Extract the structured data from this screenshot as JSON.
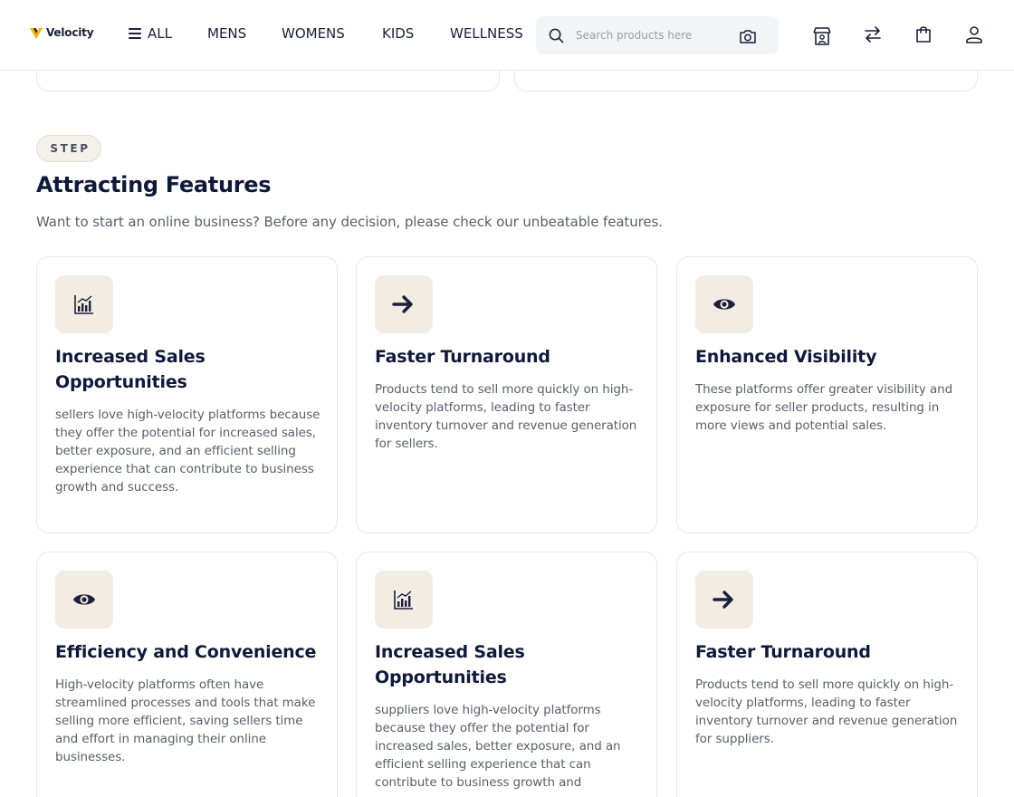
{
  "header": {
    "logo_text": "Velocity",
    "nav": [
      "ALL",
      "MENS",
      "WOMENS",
      "KIDS",
      "WELLNESS"
    ],
    "search_placeholder": "Search products here",
    "icons": [
      "store-icon",
      "compare-icon",
      "bag-icon",
      "user-icon"
    ]
  },
  "section": {
    "badge": "STEP",
    "title": "Attracting Features",
    "subtitle": "Want to start an online business? Before any decision, please check our unbeatable features."
  },
  "cards": [
    {
      "icon": "chart-icon",
      "title": "Increased Sales Opportunities",
      "desc": "sellers love high-velocity platforms because they offer the potential for increased sales, better exposure, and an efficient selling experience that can contribute to business growth and success."
    },
    {
      "icon": "arrow-right-icon",
      "title": "Faster Turnaround",
      "desc": "Products tend to sell more quickly on high-velocity platforms, leading to faster inventory turnover and revenue generation for sellers."
    },
    {
      "icon": "eye-icon",
      "title": "Enhanced Visibility",
      "desc": "These platforms offer greater visibility and exposure for seller products, resulting in more views and potential sales."
    },
    {
      "icon": "eye-icon",
      "title": "Efficiency and Convenience",
      "desc": "High-velocity platforms often have streamlined processes and tools that make selling more efficient, saving sellers time and effort in managing their online businesses."
    },
    {
      "icon": "chart-icon",
      "title": "Increased Sales Opportunities",
      "desc": "suppliers love high-velocity platforms because they offer the potential for increased sales, better exposure, and an efficient selling experience that can contribute to business growth and"
    },
    {
      "icon": "arrow-right-icon",
      "title": "Faster Turnaround",
      "desc": "Products tend to sell more quickly on high-velocity platforms, leading to faster inventory turnover and revenue generation for suppliers."
    }
  ],
  "colors": {
    "brand_navy": "#0f1a3a",
    "logo_gold": "#f5b400",
    "icon_box": "#f3ece2",
    "badge_bg": "#f4f1ec",
    "text_muted": "#5a5f6b"
  }
}
